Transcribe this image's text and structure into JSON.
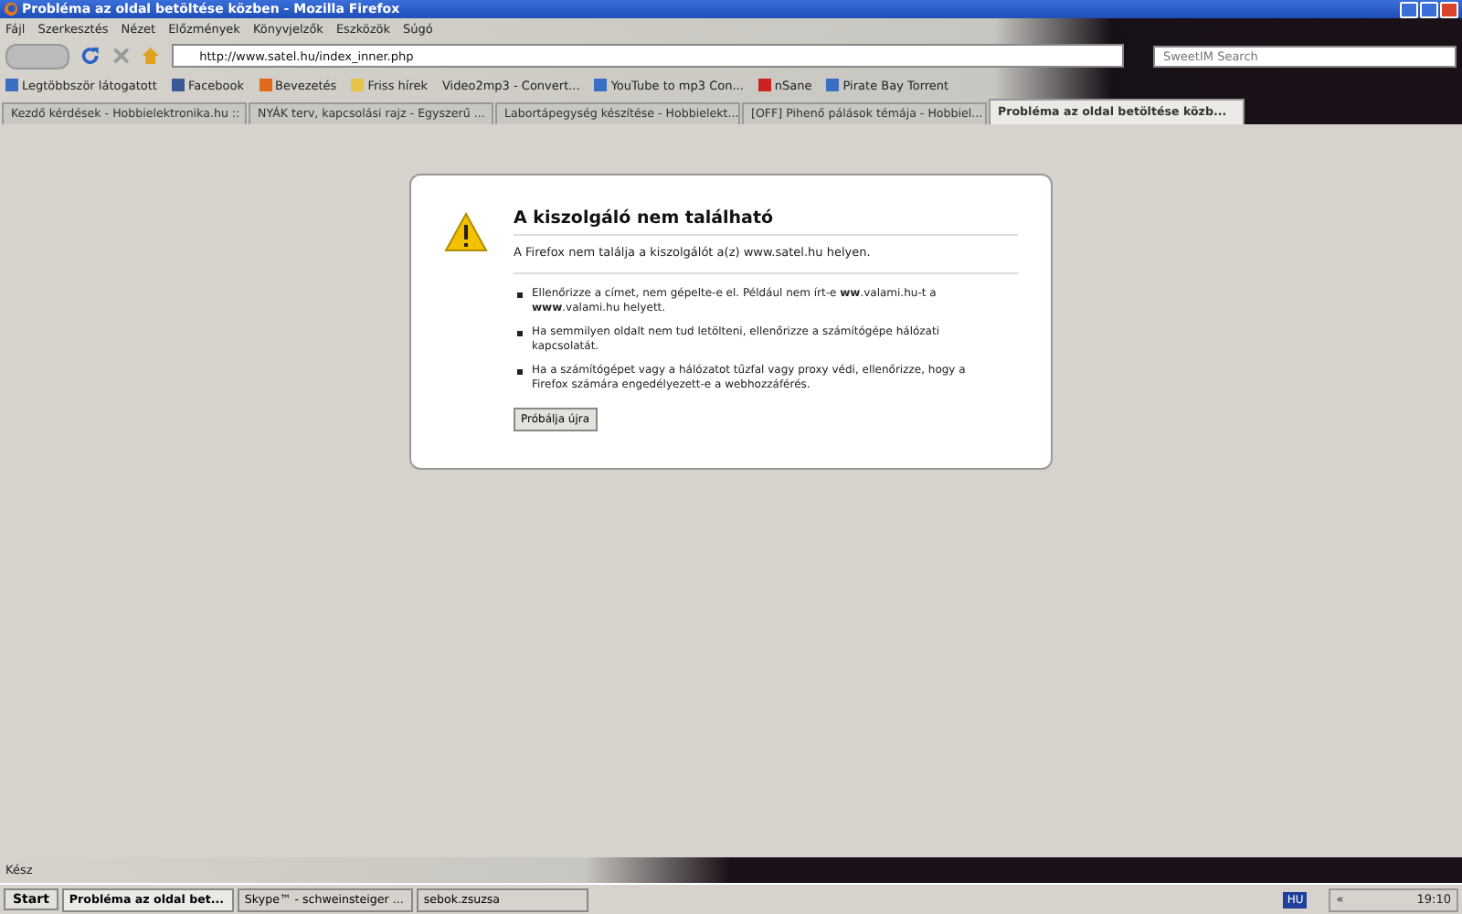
{
  "window": {
    "title": "Probléma az oldal betöltése közben - Mozilla Firefox"
  },
  "menu": [
    "Fájl",
    "Szerkesztés",
    "Nézet",
    "Előzmények",
    "Könyvjelzők",
    "Eszközök",
    "Súgó"
  ],
  "address": {
    "value": "http://www.satel.hu/index_inner.php"
  },
  "search": {
    "placeholder": "SweetIM Search"
  },
  "bookmarks": [
    {
      "label": "Legtöbbször látogatott",
      "kind": "page"
    },
    {
      "label": "Facebook",
      "kind": "facebook"
    },
    {
      "label": "Bevezetés",
      "kind": "firefox"
    },
    {
      "label": "Friss hírek",
      "kind": "folder"
    },
    {
      "label": "Video2mp3 - Convert...",
      "kind": "none"
    },
    {
      "label": "YouTube to mp3 Con...",
      "kind": "page"
    },
    {
      "label": "nSane",
      "kind": "red"
    },
    {
      "label": "Pirate Bay Torrent",
      "kind": "page"
    }
  ],
  "tabs": [
    {
      "label": "Kezdő kérdések - Hobbielektronika.hu ::",
      "selected": false
    },
    {
      "label": "NYÁK terv, kapcsolási rajz - Egyszerű ...",
      "selected": false
    },
    {
      "label": "Labortápegység készítése - Hobbielekt...",
      "selected": false
    },
    {
      "label": "[OFF] Pihenő pálások témája - Hobbiel...",
      "selected": false
    },
    {
      "label": "Probléma az oldal betöltése közb...",
      "selected": true
    }
  ],
  "error": {
    "title": "A kiszolgáló nem található",
    "message": "A Firefox nem találja a kiszolgálót a(z) www.satel.hu helyen.",
    "tips": [
      "Ellenőrizze a címet, nem gépelte-e el. Például nem írt-e **ww**.valami.hu-t a **www**.valami.hu helyett.",
      "Ha semmilyen oldalt nem tud letölteni, ellenőrizze a számítógépe hálózati kapcsolatát.",
      "Ha a számítógépet vagy a hálózatot tűzfal vagy proxy védi, ellenőrizze, hogy a Firefox számára engedélyezett-e a webhozzáférés."
    ],
    "button": "Próbálja újra"
  },
  "status_bar": "Kész",
  "taskbar": {
    "start": "Start",
    "items": [
      {
        "label": "Probléma az oldal bet...",
        "selected": true
      },
      {
        "label": "Skype™ - schweinsteiger ...",
        "selected": false
      },
      {
        "label": "sebok.zsuzsa",
        "selected": false
      }
    ],
    "language": "HU",
    "expand": "«",
    "clock": "19:10"
  }
}
